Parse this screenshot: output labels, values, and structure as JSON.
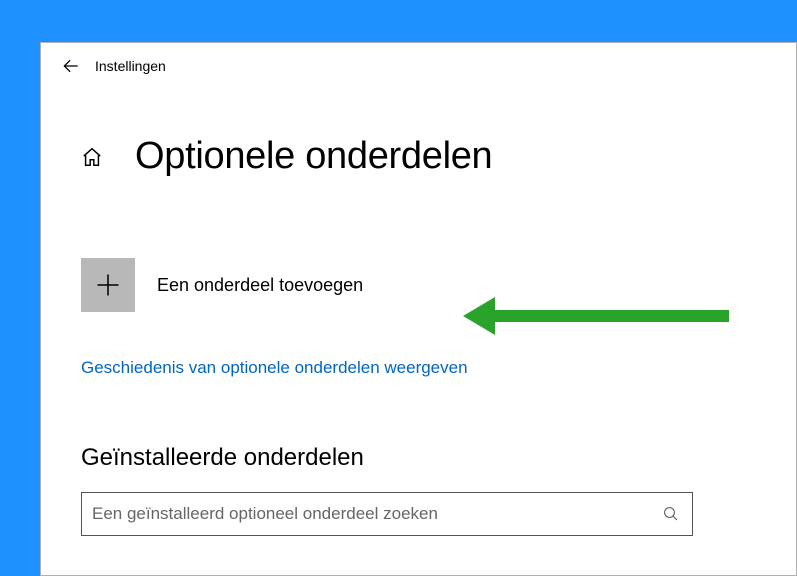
{
  "app": {
    "title": "Instellingen"
  },
  "page": {
    "title": "Optionele onderdelen",
    "add_label": "Een onderdeel toevoegen",
    "history_link": "Geschiedenis van optionele onderdelen weergeven",
    "installed_section": "Geïnstalleerde onderdelen",
    "search_placeholder": "Een geïnstalleerd optioneel onderdeel zoeken"
  },
  "colors": {
    "link": "#0066c0",
    "accent": "#2aa32a"
  }
}
